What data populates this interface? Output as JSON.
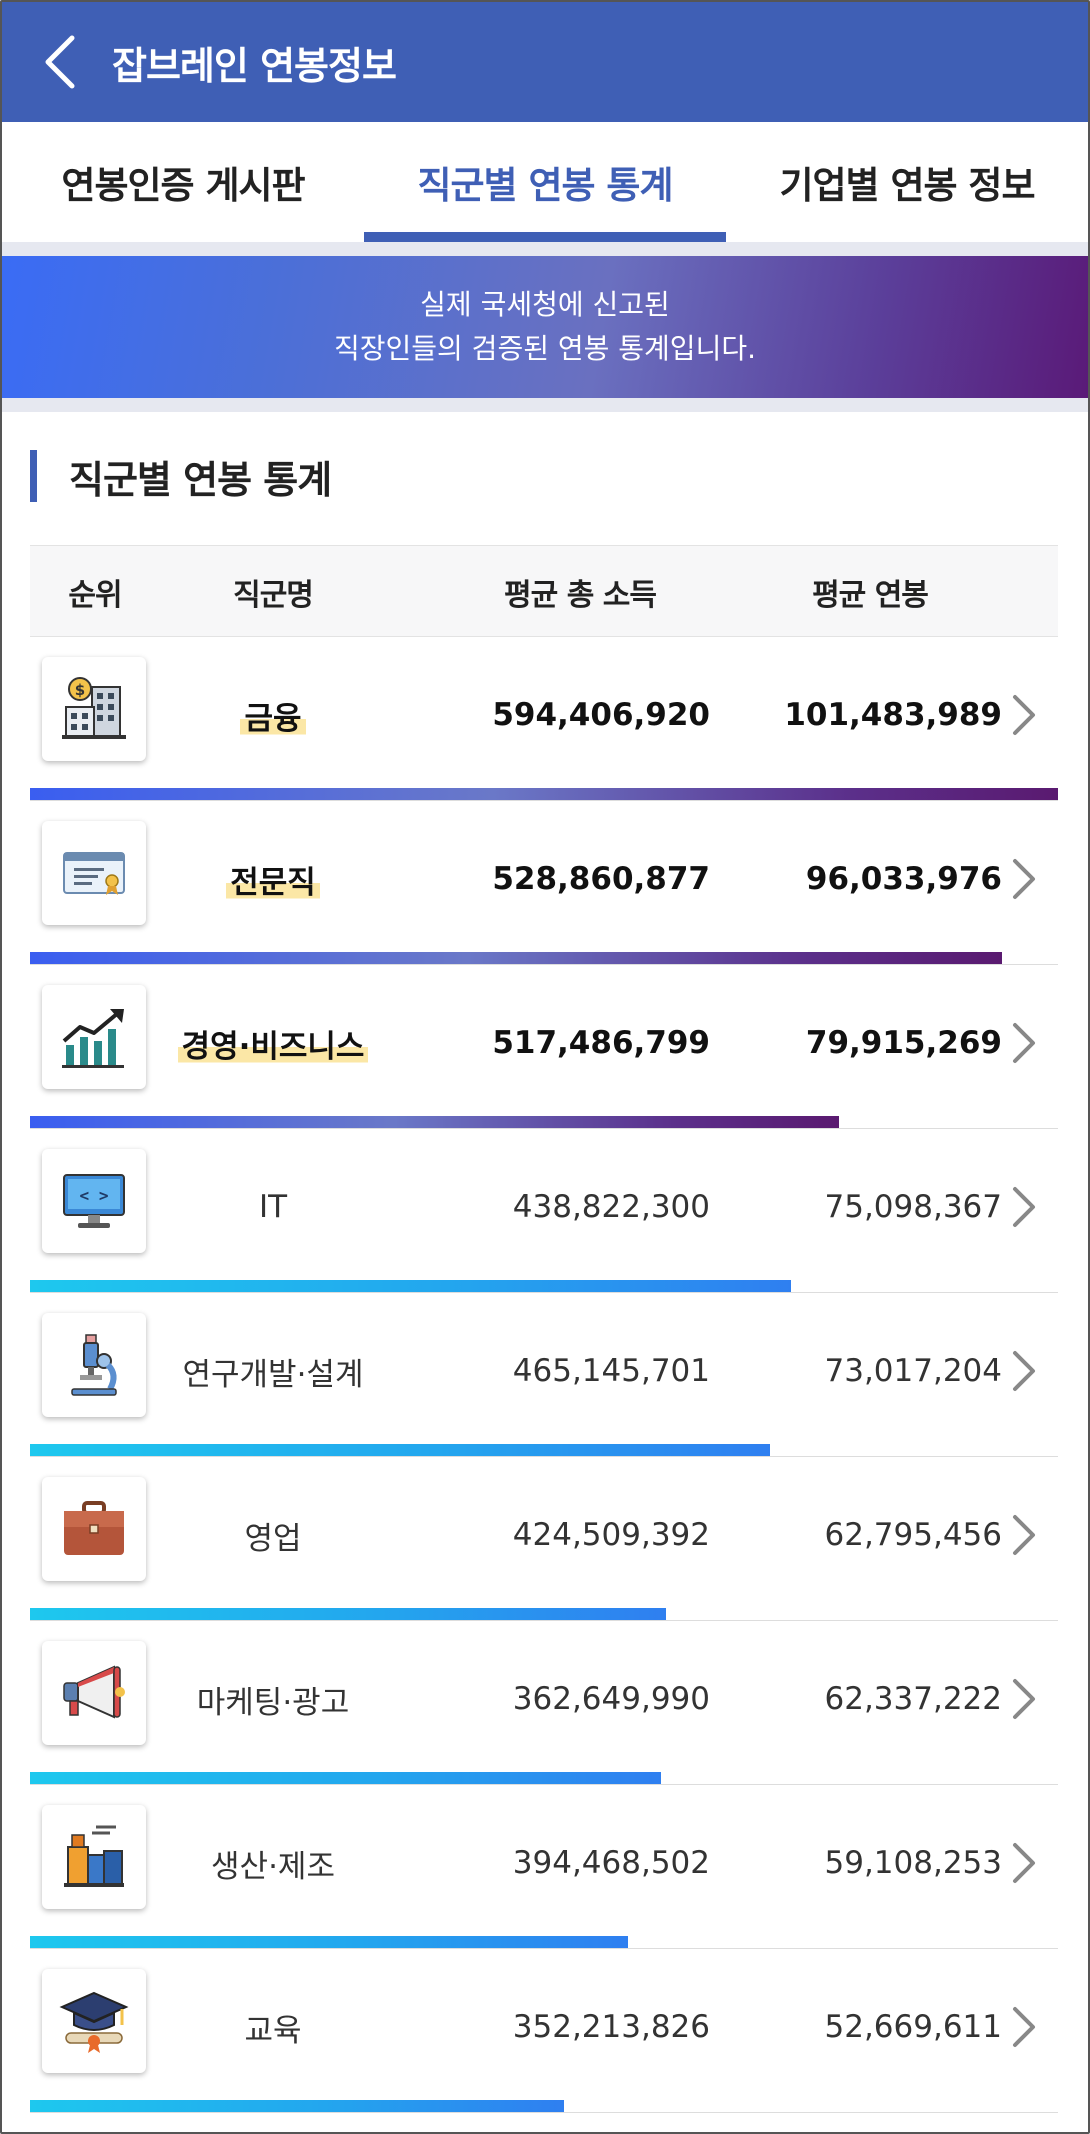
{
  "app": {
    "title": "잡브레인 연봉정보"
  },
  "tabs": [
    {
      "label": "연봉인증 게시판",
      "active": false
    },
    {
      "label": "직군별 연봉 통계",
      "active": true
    },
    {
      "label": "기업별 연봉 정보",
      "active": false
    }
  ],
  "banner": {
    "line1": "실제 국세청에 신고된",
    "line2": "직장인들의 검증된 연봉 통계입니다."
  },
  "section": {
    "title": "직군별 연봉 통계"
  },
  "table": {
    "headers": {
      "rank": "순위",
      "job": "직군명",
      "total": "평균 총 소득",
      "annual": "평균 연봉"
    },
    "rows": [
      {
        "icon": "finance-building-icon",
        "name": "금융",
        "total": "594,406,920",
        "annual": "101,483,989",
        "bar_fraction": 1.0,
        "top": true
      },
      {
        "icon": "certificate-icon",
        "name": "전문직",
        "total": "528,860,877",
        "annual": "96,033,976",
        "bar_fraction": 0.946,
        "top": true
      },
      {
        "icon": "growth-chart-icon",
        "name": "경영·비즈니스",
        "total": "517,486,799",
        "annual": "79,915,269",
        "bar_fraction": 0.787,
        "top": true
      },
      {
        "icon": "computer-monitor-icon",
        "name": "IT",
        "total": "438,822,300",
        "annual": "75,098,367",
        "bar_fraction": 0.74,
        "top": false
      },
      {
        "icon": "microscope-icon",
        "name": "연구개발·설계",
        "total": "465,145,701",
        "annual": "73,017,204",
        "bar_fraction": 0.72,
        "top": false
      },
      {
        "icon": "briefcase-icon",
        "name": "영업",
        "total": "424,509,392",
        "annual": "62,795,456",
        "bar_fraction": 0.619,
        "top": false
      },
      {
        "icon": "megaphone-icon",
        "name": "마케팅·광고",
        "total": "362,649,990",
        "annual": "62,337,222",
        "bar_fraction": 0.614,
        "top": false
      },
      {
        "icon": "factory-icon",
        "name": "생산·제조",
        "total": "394,468,502",
        "annual": "59,108,253",
        "bar_fraction": 0.582,
        "top": false
      },
      {
        "icon": "graduation-cap-icon",
        "name": "교육",
        "total": "352,213,826",
        "annual": "52,669,611",
        "bar_fraction": 0.519,
        "top": false
      }
    ]
  }
}
